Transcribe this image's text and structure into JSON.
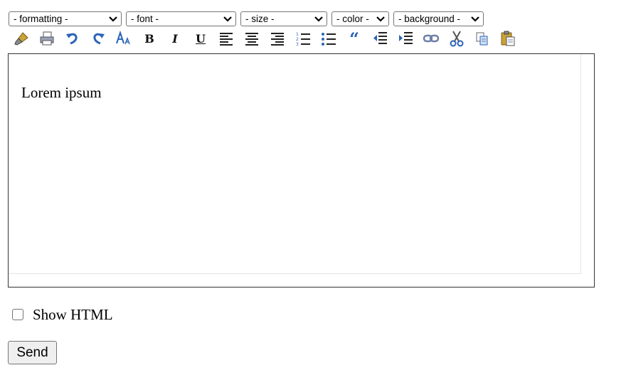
{
  "toolbar": {
    "dropdowns": [
      {
        "name": "formatting",
        "selected": "- formatting -"
      },
      {
        "name": "font",
        "selected": "- font -"
      },
      {
        "name": "size",
        "selected": "- size -"
      },
      {
        "name": "color",
        "selected": "- color -"
      },
      {
        "name": "background",
        "selected": "- background -"
      }
    ],
    "buttons": [
      {
        "id": "clean",
        "icon": "brush-icon"
      },
      {
        "id": "print",
        "icon": "print-icon"
      },
      {
        "id": "undo",
        "icon": "undo-icon"
      },
      {
        "id": "redo",
        "icon": "redo-icon"
      },
      {
        "id": "font-size",
        "icon": "font-size-icon"
      },
      {
        "id": "bold",
        "icon": "bold-icon",
        "glyph": "B"
      },
      {
        "id": "italic",
        "icon": "italic-icon",
        "glyph": "I"
      },
      {
        "id": "underline",
        "icon": "underline-icon",
        "glyph": "U"
      },
      {
        "id": "align-left",
        "icon": "align-left-icon"
      },
      {
        "id": "align-center",
        "icon": "align-center-icon"
      },
      {
        "id": "align-right",
        "icon": "align-right-icon"
      },
      {
        "id": "ordered-list",
        "icon": "ordered-list-icon"
      },
      {
        "id": "unordered-list",
        "icon": "unordered-list-icon"
      },
      {
        "id": "blockquote",
        "icon": "quote-icon",
        "glyph": "“"
      },
      {
        "id": "outdent",
        "icon": "outdent-icon"
      },
      {
        "id": "indent",
        "icon": "indent-icon"
      },
      {
        "id": "link",
        "icon": "link-icon"
      },
      {
        "id": "cut",
        "icon": "scissors-icon"
      },
      {
        "id": "copy",
        "icon": "copy-icon"
      },
      {
        "id": "paste",
        "icon": "paste-icon"
      }
    ]
  },
  "editor": {
    "content": "Lorem ipsum"
  },
  "show_html": {
    "label": "Show HTML",
    "checked": false
  },
  "send_button": {
    "label": "Send"
  }
}
